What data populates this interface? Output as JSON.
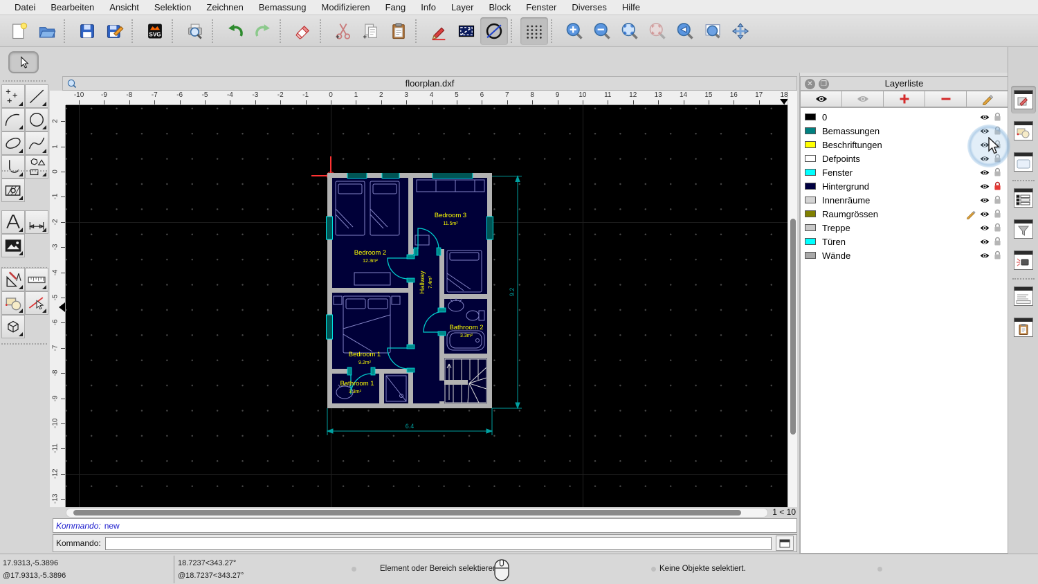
{
  "menu": {
    "items": [
      "Datei",
      "Bearbeiten",
      "Ansicht",
      "Selektion",
      "Zeichnen",
      "Bemassung",
      "Modifizieren",
      "Fang",
      "Info",
      "Layer",
      "Block",
      "Fenster",
      "Diverses",
      "Hilfe"
    ]
  },
  "toolbar": {
    "svg_label": "SVG",
    "items": [
      "new-file",
      "open-file",
      "save",
      "save-as",
      "svg-export",
      "print-preview",
      "undo",
      "redo",
      "delete",
      "cut",
      "copy",
      "paste",
      "draw-pencil",
      "draft-mode",
      "screen-linetypes",
      "grid-toggle",
      "zoom-in",
      "zoom-out",
      "zoom-auto",
      "zoom-selection",
      "zoom-previous",
      "zoom-window",
      "pan"
    ]
  },
  "left_tools": [
    "selection-pointer",
    "points",
    "line",
    "arc",
    "circle",
    "ellipse",
    "spline",
    "polyline",
    "shapes",
    "hatch",
    "text",
    "dimension",
    "image",
    "drafting-aids",
    "measure",
    "block",
    "select-entity",
    "solid-3d"
  ],
  "window": {
    "title": "floorplan.dxf"
  },
  "rulers": {
    "h_min": -10,
    "h_max": 18,
    "v_min": -13,
    "v_max": 2,
    "h_marker": 18,
    "v_marker": -5.39
  },
  "scroll": {
    "zoom_indicator": "1 < 10"
  },
  "command": {
    "history_label": "Kommando:",
    "history_value": "new",
    "prompt_label": "Kommando:"
  },
  "statusbar": {
    "abs_cartesian": "17.9313,-5.3896",
    "rel_cartesian": "@17.9313,-5.3896",
    "abs_polar": "18.7237<343.27°",
    "rel_polar": "@18.7237<343.27°",
    "hint": "Element oder Bereich selektieren",
    "selection_status": "Keine Objekte selektiert."
  },
  "layer_panel": {
    "title": "Layerliste",
    "layers": [
      {
        "name": "0",
        "color": "#000000",
        "visible": true,
        "locked": false,
        "current": false
      },
      {
        "name": "Bemassungen",
        "color": "#008080",
        "visible": true,
        "locked": false,
        "current": false
      },
      {
        "name": "Beschriftungen",
        "color": "#ffff00",
        "visible": true,
        "locked": false,
        "current": false
      },
      {
        "name": "Defpoints",
        "color": "#ffffff",
        "visible": true,
        "locked": false,
        "current": false
      },
      {
        "name": "Fenster",
        "color": "#00ffff",
        "visible": true,
        "locked": false,
        "current": false
      },
      {
        "name": "Hintergrund",
        "color": "#000040",
        "visible": true,
        "locked": true,
        "current": false
      },
      {
        "name": "Innenräume",
        "color": "#d4d4d4",
        "visible": true,
        "locked": false,
        "current": false
      },
      {
        "name": "Raumgrössen",
        "color": "#808000",
        "visible": true,
        "locked": false,
        "current": true
      },
      {
        "name": "Treppe",
        "color": "#c8c8c8",
        "visible": true,
        "locked": false,
        "current": false
      },
      {
        "name": "Türen",
        "color": "#00ffff",
        "visible": true,
        "locked": false,
        "current": false
      },
      {
        "name": "Wände",
        "color": "#a8a8a8",
        "visible": true,
        "locked": false,
        "current": false
      }
    ]
  },
  "floorplan": {
    "rooms": [
      {
        "name": "Bedroom 2",
        "area": "12.3m²"
      },
      {
        "name": "Bedroom 3",
        "area": "11.5m²"
      },
      {
        "name": "Hallway",
        "area": "7.4m²"
      },
      {
        "name": "Bedroom 1",
        "area": "9.2m²"
      },
      {
        "name": "Bathroom 1",
        "area": "3.3m²"
      },
      {
        "name": "Bathroom 2",
        "area": "3.3m²"
      }
    ],
    "dimensions": {
      "width": "6.4",
      "height": "9.2"
    },
    "colors": {
      "walls": "#b2b2b2",
      "interior": "#000038",
      "furniture": "#8585c7",
      "doors": "#00cccc",
      "windows": "#00e0e0",
      "labels": "#ffff00",
      "dimension": "#00a0a0",
      "stairs": "#d8d8d8"
    }
  }
}
